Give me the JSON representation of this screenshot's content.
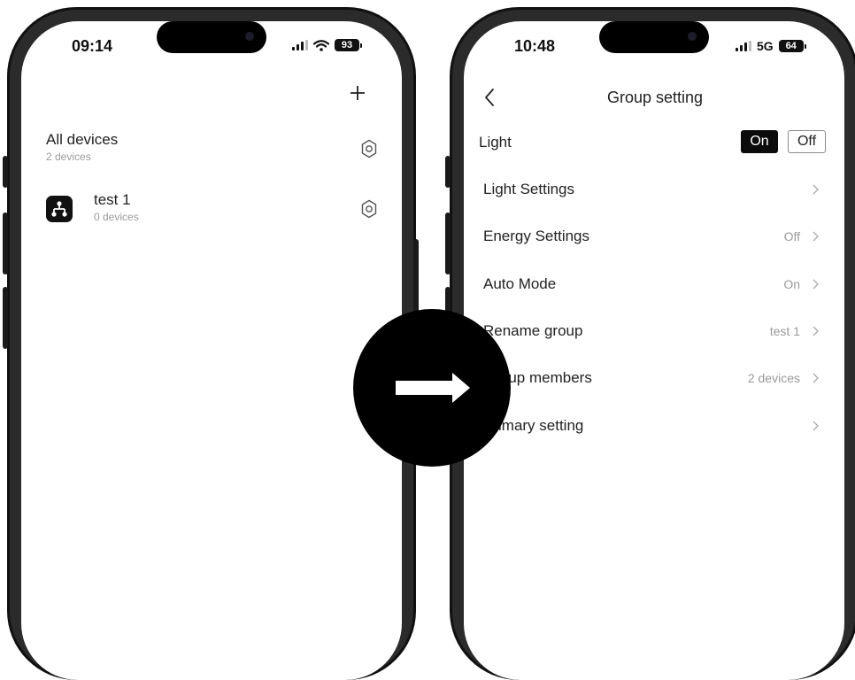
{
  "left_phone": {
    "status": {
      "time": "09:14",
      "battery": "93"
    },
    "add_icon": "plus-icon",
    "all_devices": {
      "title": "All devices",
      "subtitle": "2 devices",
      "settings_icon": "gear-icon"
    },
    "groups": [
      {
        "name": "test 1",
        "subtitle": "0 devices",
        "icon": "group-hierarchy-icon",
        "settings_icon": "gear-icon"
      }
    ]
  },
  "right_phone": {
    "status": {
      "time": "10:48",
      "network": "5G",
      "battery": "64"
    },
    "nav": {
      "back_icon": "chevron-left-icon",
      "title": "Group setting"
    },
    "light": {
      "label": "Light",
      "on_label": "On",
      "off_label": "Off",
      "selected": "On"
    },
    "settings_rows": [
      {
        "label": "Light Settings",
        "value": ""
      },
      {
        "label": "Energy Settings",
        "value": "Off"
      },
      {
        "label": "Auto Mode",
        "value": "On"
      },
      {
        "label": "Rename group",
        "value": "test 1"
      },
      {
        "label": "Group members",
        "value": "2 devices"
      },
      {
        "label": "Primary setting",
        "value": ""
      }
    ]
  },
  "overlay": {
    "icon": "arrow-right-icon",
    "circle_color": "#000000"
  }
}
